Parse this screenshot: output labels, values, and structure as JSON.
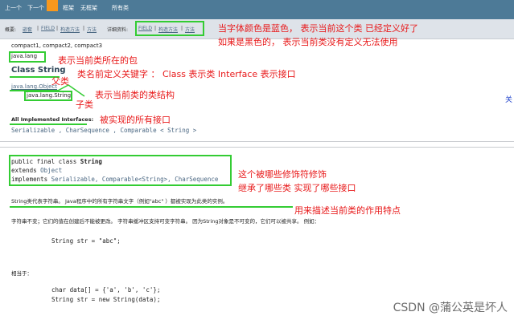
{
  "top_nav": {
    "items": [
      "上一个",
      "下一个",
      "框架",
      "无框架",
      "所有类"
    ]
  },
  "sub_nav": {
    "left_label": "概要:",
    "left_links": [
      "嵌套",
      "FIELD",
      "构造方法",
      "方法"
    ],
    "right_label": "详细资料:",
    "right_links": [
      "FIELD",
      "构造方法",
      "方法"
    ]
  },
  "content": {
    "compact": "compact1, compact2, compact3",
    "package": "java.lang",
    "class_title": "Class String",
    "hierarchy": [
      "java.lang.Object",
      "java.lang.String"
    ],
    "interfaces_label": "All Implemented Interfaces:",
    "interfaces": "Serializable ,  CharSequence ,  Comparable < String >",
    "decl": {
      "line1_pre": "public final class ",
      "line1_name": "String",
      "line2_pre": "extends ",
      "line2_link": "Object",
      "line3_pre": "implements ",
      "line3_links": "Serializable, Comparable<String>, CharSequence"
    },
    "desc_line": "String类代表字符串。 Java程序中的所有字符串文字（例如\"abc\" ）都被实现为此类的实例。",
    "para1": "字符串不变；它们的值在创建后不能被更改。 字符串缓冲区支持可变字符串。 因为String对象是不可变的，它们可以被共享。 例如：",
    "code1": "String str = \"abc\";",
    "equiv": "相当于：",
    "code2": "char data[] = {'a', 'b', 'c'};",
    "code3": "String str = new String(data);"
  },
  "annotations": {
    "a1": "当字体颜色是蓝色， 表示当前这个类 已经定义好了",
    "a2": "如果是黑色的， 表示当前类没有定义无法使用",
    "a3": "表示当前类所在的包",
    "a4": "类名前定义关键字 ： Class 表示类  Interface 表示接口",
    "a5": "父类",
    "a6": "表示当前类的类结构",
    "a7": "子类",
    "a8": "被实现的所有接口",
    "a9": "这个被哪些修饰符修饰",
    "a10": "继承了哪些类 实现了哪些接口",
    "a11": "用来描述当前类的作用特点",
    "side_char": "关"
  },
  "watermark": "CSDN @蒲公英是坏人",
  "colors": {
    "top_bar": "#4d7a97",
    "sub_bar": "#dee3e9",
    "highlight_box": "#33cc33",
    "annotation": "#e8191a",
    "link_blue": "#4a6782"
  }
}
